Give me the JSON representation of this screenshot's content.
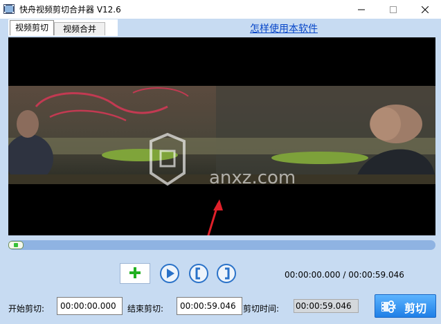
{
  "window": {
    "title": "快舟视频剪切合并器 V12.6",
    "icons": {
      "app": "film-icon",
      "minimize": "minimize-icon",
      "maximize": "maximize-icon",
      "close": "close-icon"
    }
  },
  "tabs": [
    {
      "label": "视频剪切",
      "active": true
    },
    {
      "label": "视频合并",
      "active": false
    }
  ],
  "help_link": "怎样使用本软件",
  "player": {
    "progress_fraction": 0.0,
    "watermark": "anxz.com",
    "icons": {
      "add": "plus-icon",
      "play": "play-icon",
      "mark_start": "bracket-left-icon",
      "mark_end": "bracket-right-icon"
    },
    "time_display": "00:00:00.000 / 00:00:59.046"
  },
  "cut_controls": {
    "start_label": "开始剪切:",
    "start_value": "00:00:00.000",
    "end_label": "结束剪切:",
    "end_value": "00:00:59.046",
    "duration_label": "剪切时间:",
    "duration_value": "00:00:59.046"
  },
  "cut_button": {
    "label": "剪切",
    "icon": "scissors-film-icon"
  },
  "colors": {
    "background": "#c7dbf2",
    "link": "#0645c8",
    "accent": "#1f7fe6",
    "progress_track": "#8fb3e2",
    "play_button": "#2a72c8"
  }
}
